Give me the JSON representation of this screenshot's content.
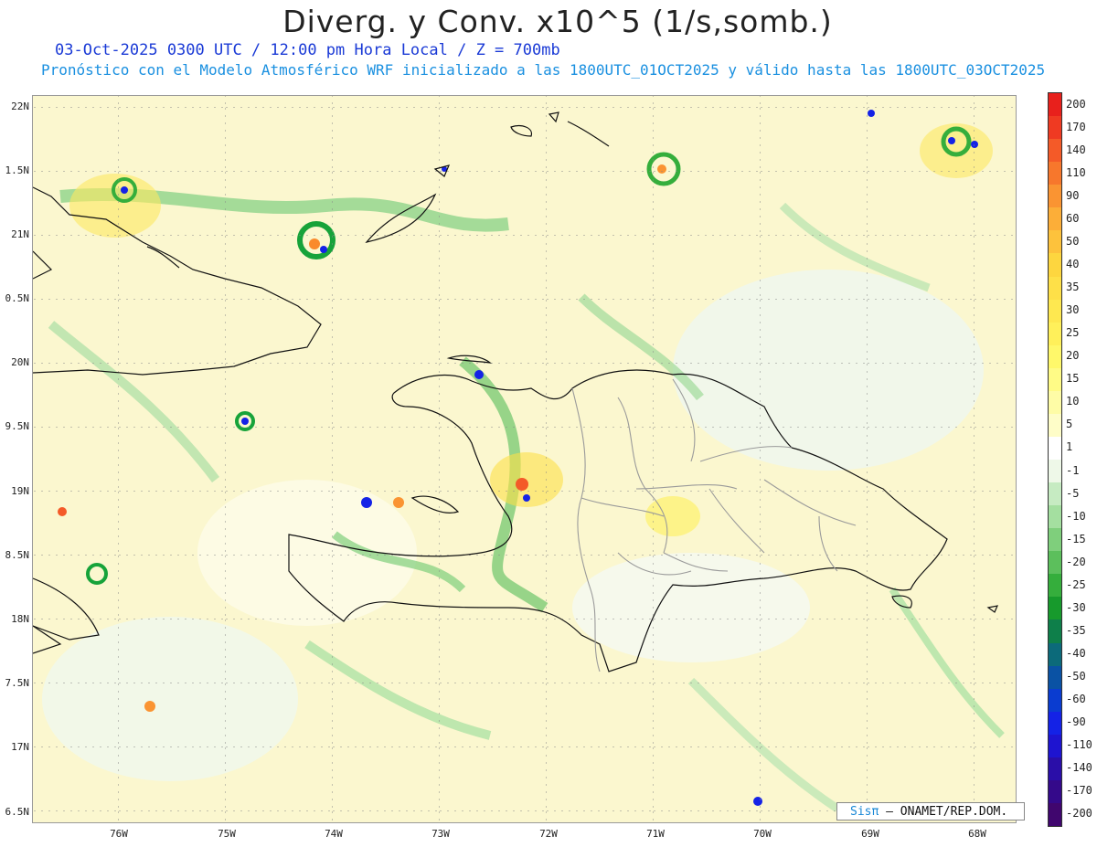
{
  "header": {
    "title": "Diverg. y Conv. x10^5 (1/s,somb.)",
    "subtitle_date": "03-Oct-2025  0300 UTC / 12:00 pm Hora Local / Z = 700mb",
    "subtitle_model": "Pronóstico con el Modelo Atmosférico WRF inicializado a las 1800UTC_01OCT2025 y válido hasta las  1800UTC_03OCT2025"
  },
  "axes": {
    "lat_labels": [
      "22N",
      "1.5N",
      "21N",
      "0.5N",
      "20N",
      "9.5N",
      "19N",
      "8.5N",
      "18N",
      "7.5N",
      "17N",
      "6.5N"
    ],
    "lon_labels": [
      "76W",
      "75W",
      "74W",
      "73W",
      "72W",
      "71W",
      "70W",
      "69W",
      "68W"
    ]
  },
  "colorbar": {
    "labels": [
      "200",
      "170",
      "140",
      "110",
      "90",
      "60",
      "50",
      "40",
      "35",
      "30",
      "25",
      "20",
      "15",
      "10",
      "5",
      "1",
      "-1",
      "-5",
      "-10",
      "-15",
      "-20",
      "-25",
      "-30",
      "-35",
      "-40",
      "-50",
      "-60",
      "-90",
      "-110",
      "-140",
      "-170",
      "-200"
    ],
    "colors": [
      "#e8201c",
      "#ef3a22",
      "#f45a28",
      "#f7772c",
      "#fa9432",
      "#fcae38",
      "#fdc23c",
      "#fdd63f",
      "#fee048",
      "#fee850",
      "#fff05a",
      "#fff86a",
      "#fffb86",
      "#fefca6",
      "#fefdc8",
      "#ffffff",
      "#eef8e8",
      "#c6ebc2",
      "#a4dfa0",
      "#7fcf7c",
      "#5cbf5c",
      "#35ae3c",
      "#179a2c",
      "#0e7f4a",
      "#0c6a7a",
      "#0a52a4",
      "#0a3cd0",
      "#1422e6",
      "#1e14d0",
      "#2a0ea8",
      "#34098a",
      "#40066e"
    ]
  },
  "credit": {
    "brand": "Sisπ",
    "text": "– ONAMET/REP.DOM."
  }
}
